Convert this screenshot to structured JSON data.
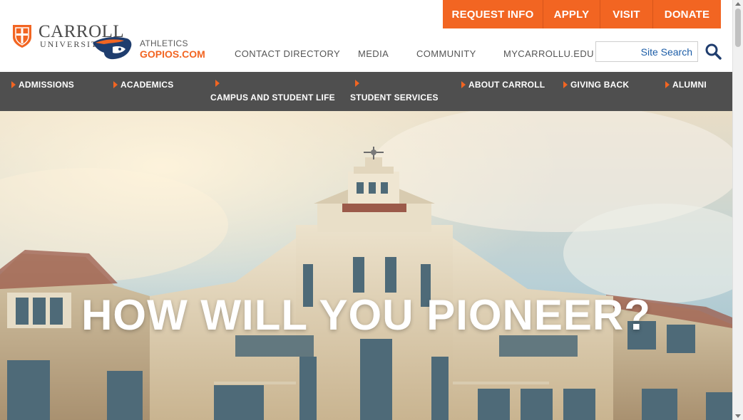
{
  "brand": {
    "name_line1": "CARROLL",
    "name_line2": "UNIVERSITY",
    "accent": "#f26522",
    "nav_bg": "#4f4f4f"
  },
  "athletics": {
    "label": "ATHLETICS",
    "site": "GOPIOS.COM"
  },
  "cta_buttons": [
    {
      "label": "REQUEST INFO"
    },
    {
      "label": "APPLY"
    },
    {
      "label": "VISIT"
    },
    {
      "label": "DONATE"
    }
  ],
  "utility_links": [
    {
      "label": "CONTACT DIRECTORY"
    },
    {
      "label": "MEDIA"
    },
    {
      "label": "COMMUNITY"
    },
    {
      "label": "MYCARROLLU.EDU"
    }
  ],
  "search": {
    "placeholder": "Site Search",
    "icon": "search-icon"
  },
  "main_nav": [
    {
      "label": "ADMISSIONS"
    },
    {
      "label": "ACADEMICS"
    },
    {
      "label": "CAMPUS AND STUDENT LIFE"
    },
    {
      "label": "STUDENT SERVICES"
    },
    {
      "label": "ABOUT CARROLL"
    },
    {
      "label": "GIVING BACK"
    },
    {
      "label": "ALUMNI"
    }
  ],
  "hero": {
    "title": "HOW WILL YOU PIONEER?"
  }
}
